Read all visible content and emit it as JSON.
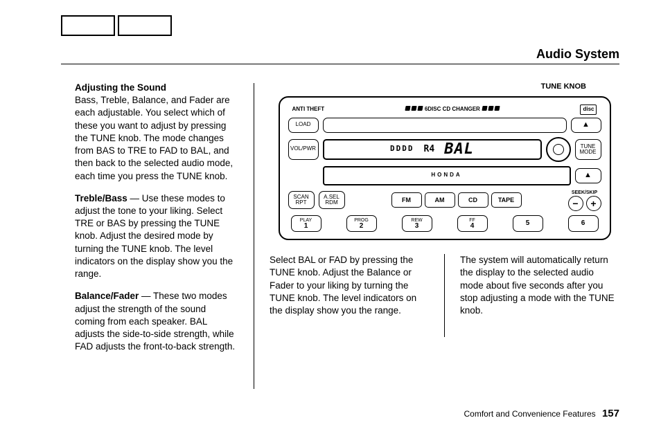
{
  "header": {
    "title": "Audio System"
  },
  "col1": {
    "h1": "Adjusting the Sound",
    "p1": "Bass, Treble, Balance, and Fader are each adjustable. You select which of these you want to adjust by pressing the TUNE knob. The mode changes from BAS to TRE to FAD to BAL, and then back to the selected audio mode, each time you press the TUNE knob.",
    "h2": "Treble/Bass",
    "p2": " — Use these modes to adjust the tone to your liking. Select TRE or BAS by pressing the TUNE knob. Adjust the desired mode by turning the TUNE knob. The level indicators on the display show you the range.",
    "h3": "Balance/Fader",
    "p3": " — These two modes adjust the strength of the sound coming from each speaker. BAL adjusts the side-to-side strength, while FAD adjusts the front-to-back strength."
  },
  "radio": {
    "callout": "TUNE KNOB",
    "anti_theft": "ANTI THEFT",
    "changer": "6DISC CD CHANGER",
    "load": "LOAD",
    "vol": "VOL/PWR",
    "tune_mode": "TUNE MODE",
    "disp_bars": "DDDD",
    "disp_mid": "R4",
    "disp_main": "BAL",
    "tape_brand": "HONDA",
    "scan": "SCAN RPT",
    "asel": "A.SEL RDM",
    "fm": "FM",
    "am": "AM",
    "cd": "CD",
    "tape": "TAPE",
    "seek": "SEEK/SKIP",
    "minus": "−",
    "plus": "+",
    "b1t": "PLAY",
    "b1n": "1",
    "b2t": "PROG",
    "b2n": "2",
    "b3t": "REW",
    "b3n": "3",
    "b4t": "FF",
    "b4n": "4",
    "b5t": "",
    "b5n": "5",
    "b6t": "",
    "b6n": "6",
    "eject": "▲"
  },
  "col2": {
    "p": "Select BAL or FAD by pressing the TUNE knob. Adjust the Balance or Fader to your liking by turning the TUNE knob. The level indicators on the display show you the range."
  },
  "col3": {
    "p": "The system will automatically return the display to the selected audio mode about five seconds after you stop adjusting a mode with the TUNE knob."
  },
  "footer": {
    "section": "Comfort and Convenience Features",
    "page": "157"
  }
}
